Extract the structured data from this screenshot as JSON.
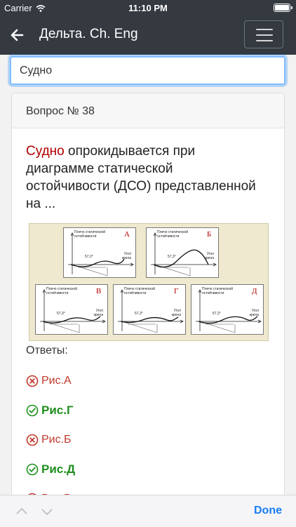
{
  "status": {
    "carrier": "Carrier",
    "time": "11:10 PM"
  },
  "header": {
    "title": "Дельта. Ch. Eng"
  },
  "search": {
    "value": "Судно"
  },
  "question": {
    "heading": "Вопрос № 38",
    "highlight": "Судно",
    "text": " опрокидывается при диаграмме статической остойчивости (ДСО) представленной на ..."
  },
  "figure": {
    "plot_label_line1": "Плечо статической",
    "plot_label_line2": "остойчивости",
    "axis_line1": "Угол",
    "axis_line2": "крена",
    "angle": "57,3°",
    "panels": [
      {
        "letter": "А"
      },
      {
        "letter": "Б"
      },
      {
        "letter": "В"
      },
      {
        "letter": "Г"
      },
      {
        "letter": "Д"
      }
    ]
  },
  "answers": {
    "label": "Ответы:",
    "items": [
      {
        "text": "Рис.А",
        "correct": false
      },
      {
        "text": "Рис.Г",
        "correct": true
      },
      {
        "text": "Рис.Б",
        "correct": false
      },
      {
        "text": "Рис.Д",
        "correct": true
      },
      {
        "text": "Рис.В",
        "correct": false
      }
    ]
  },
  "bottom": {
    "done": "Done"
  },
  "colors": {
    "navbar": "#343a40",
    "highlight": "#b00000",
    "correct": "#1e8f1e",
    "wrong": "#c0392b",
    "done": "#1a7cf5"
  }
}
